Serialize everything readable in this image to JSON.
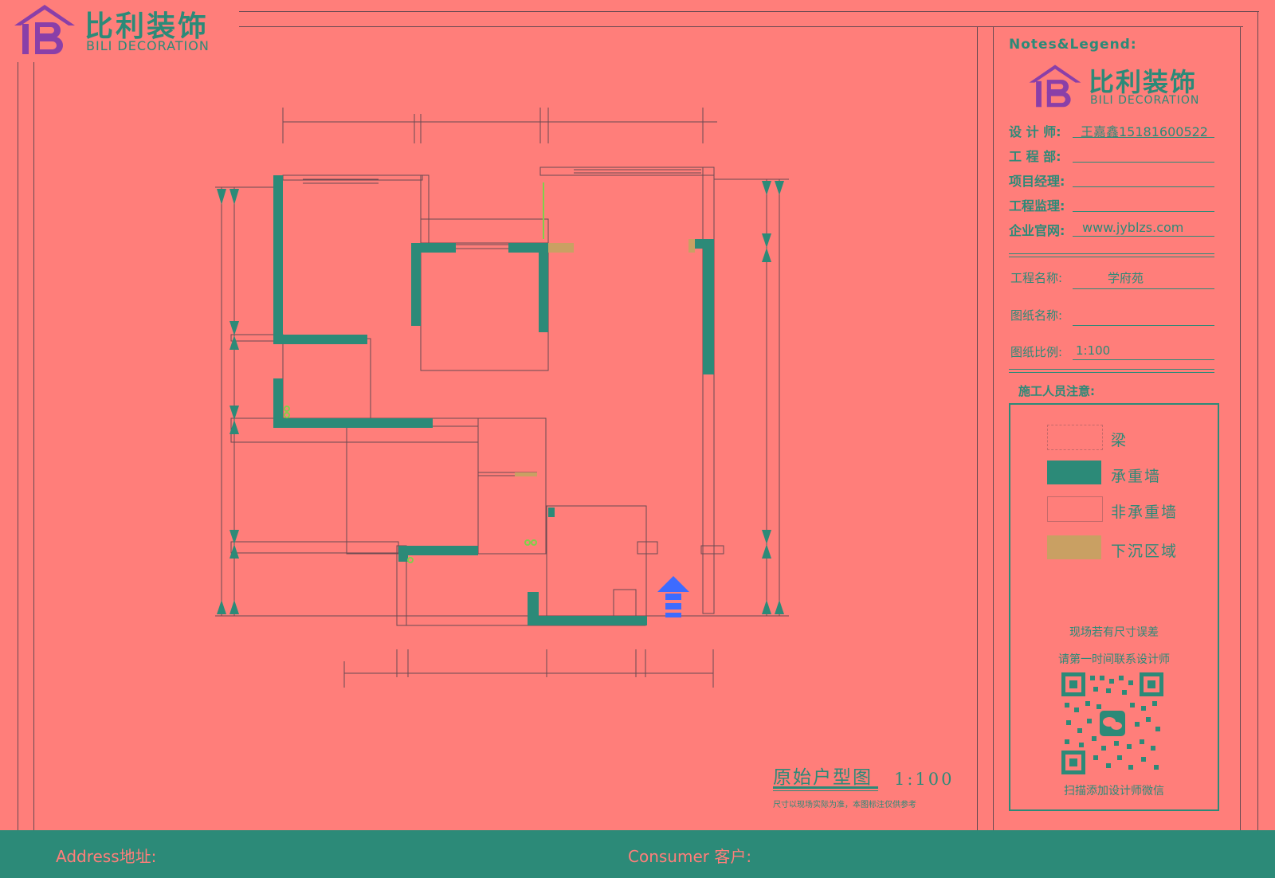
{
  "brand": {
    "name_cn": "比利装饰",
    "name_en": "BILI DECORATION"
  },
  "sidebar": {
    "notes_title": "Notes&Legend:",
    "fields": [
      {
        "label": "设 计 师:",
        "value": "王嘉鑫15181600522"
      },
      {
        "label": "工 程 部:",
        "value": ""
      },
      {
        "label": "项目经理:",
        "value": ""
      },
      {
        "label": "工程监理:",
        "value": ""
      },
      {
        "label": "企业官网:",
        "value": "www.jyblzs.com"
      }
    ],
    "project": [
      {
        "label": "工程名称:",
        "value": "学府苑"
      },
      {
        "label": "图纸名称:",
        "value": ""
      },
      {
        "label": "图纸比例:",
        "value": "1:100"
      }
    ],
    "notice_title": "施工人员注意:",
    "legend": [
      {
        "label": "梁",
        "color": "#FF7E7A",
        "style": "dashed"
      },
      {
        "label": "承重墙",
        "color": "#2C8A78",
        "style": "solid"
      },
      {
        "label": "非承重墙",
        "color": "#FF7E7A",
        "style": "outline"
      },
      {
        "label": "下沉区域",
        "color": "#C9A063",
        "style": "solid"
      }
    ],
    "notes": [
      "现场若有尺寸误差",
      "请第一时间联系设计师"
    ],
    "qr_caption": "扫描添加设计师微信"
  },
  "plan": {
    "title": "原始户型图",
    "scale": "1:100",
    "note": "尺寸以现场实际为准，本图标注仅供参考"
  },
  "footer": {
    "address_label": "Address地址:",
    "consumer_label": "Consumer 客户:"
  },
  "colors": {
    "background": "#FF7E7A",
    "accent": "#2C8A78",
    "sunken": "#C9A063",
    "arrow": "#3D6BFF",
    "light_green": "#7FD04A"
  }
}
